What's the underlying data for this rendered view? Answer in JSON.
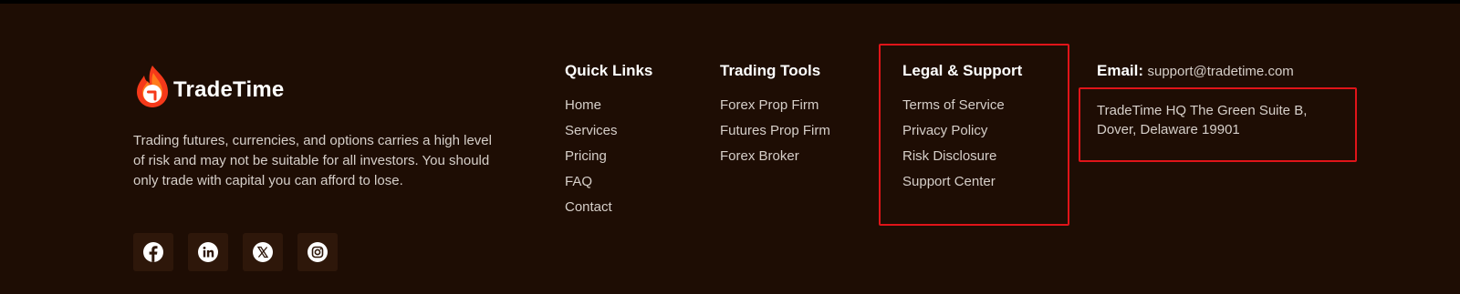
{
  "brand": {
    "name": "TradeTime",
    "logo_icon": "flame-icon",
    "accent_color": "#f5391a"
  },
  "disclaimer": "Trading futures, currencies, and options carries a high level of risk and may not be suitable for all investors. You should only trade with capital you can afford to lose.",
  "socials": [
    {
      "icon": "facebook-icon"
    },
    {
      "icon": "linkedin-icon"
    },
    {
      "icon": "x-icon"
    },
    {
      "icon": "instagram-icon"
    }
  ],
  "quick_links": {
    "title": "Quick Links",
    "items": [
      "Home",
      "Services",
      "Pricing",
      "FAQ",
      "Contact"
    ]
  },
  "trading_tools": {
    "title": "Trading Tools",
    "items": [
      "Forex Prop Firm",
      "Futures Prop Firm",
      "Forex Broker"
    ]
  },
  "legal_support": {
    "title": "Legal & Support",
    "items": [
      "Terms of Service",
      "Privacy Policy",
      "Risk Disclosure",
      "Support Center"
    ]
  },
  "contact": {
    "email_label": "Email:",
    "email": "support@tradetime.com",
    "address": "TradeTime HQ The Green Suite B, Dover, Delaware 19901"
  },
  "colors": {
    "background": "#1e0d04",
    "highlight": "#e01419"
  }
}
